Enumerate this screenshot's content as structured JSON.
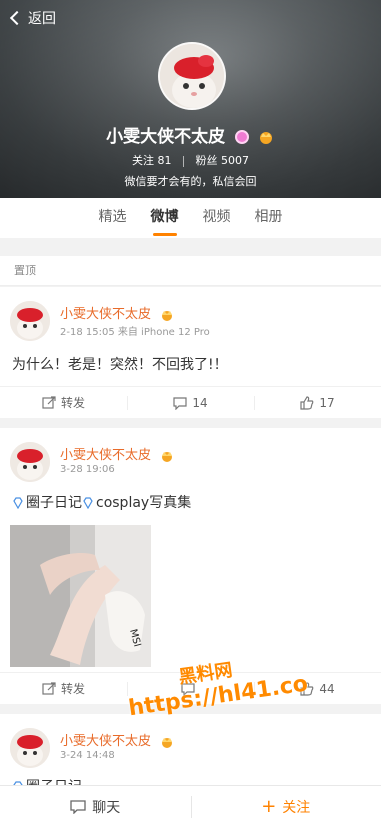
{
  "header": {
    "back_label": "返回",
    "name": "小雯大侠不太皮",
    "follow_label": "关注",
    "follow_count": "81",
    "fans_label": "粉丝",
    "fans_count": "5007",
    "description": "微信要才会有的，私信会回"
  },
  "tabs": [
    {
      "label": "精选"
    },
    {
      "label": "微博"
    },
    {
      "label": "视频"
    },
    {
      "label": "相册"
    }
  ],
  "pinned_label": "置顶",
  "posts": [
    {
      "author": "小雯大侠不太皮",
      "meta": "2-18 15:05 来自 iPhone 12 Pro",
      "text": "为什么！老是！突然！不回我了!！",
      "repost_label": "转发",
      "comment_count": "14",
      "like_count": "17"
    },
    {
      "author": "小雯大侠不太皮",
      "meta": "3-28 19:06",
      "text_a": "圈子日记",
      "text_b": "cosplay写真集",
      "repost_label": "转发",
      "like_count": "44"
    },
    {
      "author": "小雯大侠不太皮",
      "meta": "3-24 14:48",
      "text": "圈子日记"
    }
  ],
  "watermark": {
    "line1": "黑料网",
    "line2": "https://hl41.co"
  },
  "bottom_bar": {
    "chat_label": "聊天",
    "follow_label": "关注"
  },
  "colors": {
    "accent": "#ff8200",
    "name_orange": "#e86b2a",
    "diamond_blue": "#4a90e2"
  }
}
